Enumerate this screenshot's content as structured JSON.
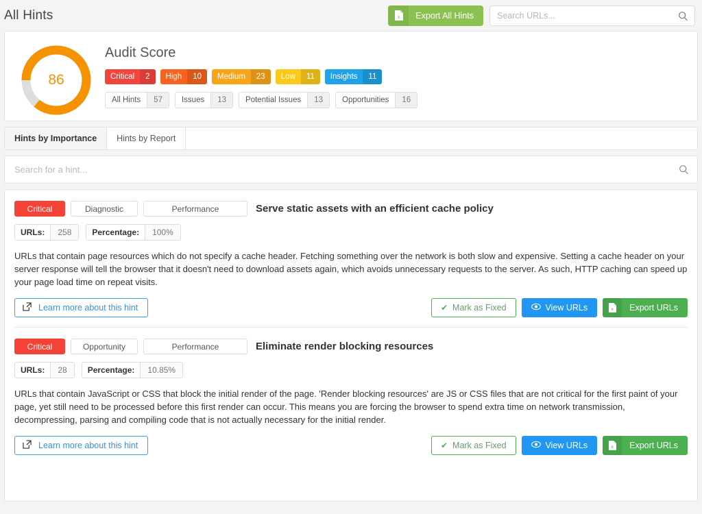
{
  "header": {
    "title": "All Hints",
    "export_all_label": "Export All Hints",
    "export_icon": "file-excel-icon",
    "search_placeholder": "Search URLs...",
    "search_value": "",
    "search_icon": "search-icon"
  },
  "score": {
    "heading": "Audit Score",
    "value": "86",
    "max": 100,
    "arc_color": "#f59200",
    "track_color": "#dddddd",
    "severities": [
      {
        "label": "Critical",
        "count": "2",
        "color": "#f4453c"
      },
      {
        "label": "High",
        "count": "10",
        "color": "#f7631e"
      },
      {
        "label": "Medium",
        "count": "23",
        "color": "#f9a51a"
      },
      {
        "label": "Low",
        "count": "11",
        "color": "#fbc91b"
      },
      {
        "label": "Insights",
        "count": "11",
        "color": "#1fa2e8"
      }
    ],
    "categories": [
      {
        "label": "All Hints",
        "count": "57"
      },
      {
        "label": "Issues",
        "count": "13"
      },
      {
        "label": "Potential Issues",
        "count": "13"
      },
      {
        "label": "Opportunities",
        "count": "16"
      }
    ]
  },
  "tabs": [
    {
      "label": "Hints by Importance",
      "active": true
    },
    {
      "label": "Hints by Report",
      "active": false
    }
  ],
  "hint_search": {
    "placeholder": "Search for a hint...",
    "value": "",
    "icon": "search-icon"
  },
  "actions": {
    "learn_more": "Learn more about this hint",
    "learn_more_icon": "external-link-icon",
    "mark_fixed": "Mark as Fixed",
    "mark_fixed_icon": "check-icon",
    "view_urls": "View URLs",
    "view_urls_icon": "eye-icon",
    "export_urls": "Export URLs",
    "export_urls_icon": "file-excel-icon"
  },
  "meta_labels": {
    "urls": "URLs:",
    "percentage": "Percentage:"
  },
  "hints": [
    {
      "severity": "Critical",
      "type": "Diagnostic",
      "category": "Performance",
      "title": "Serve static assets with an efficient cache policy",
      "urls": "258",
      "percentage": "100%",
      "description": "URLs that contain page resources which do not specify a cache header. Fetching something over the network is both slow and expensive. Setting a cache header on your server response will tell the browser that it doesn't need to download assets again, which avoids unnecessary requests to the server. As such, HTTP caching can speed up your page load time on repeat visits."
    },
    {
      "severity": "Critical",
      "type": "Opportunity",
      "category": "Performance",
      "title": "Eliminate render blocking resources",
      "urls": "28",
      "percentage": "10.85%",
      "description": "URLs that contain JavaScript or CSS that block the initial render of the page. 'Render blocking resources' are JS or CSS files that are not critical for the first paint of your page, yet still need to be processed before this first render can occur. This means you are forcing the browser to spend extra time on network transmission, decompressing, parsing and compiling code that is not actually necessary for the initial render."
    }
  ]
}
